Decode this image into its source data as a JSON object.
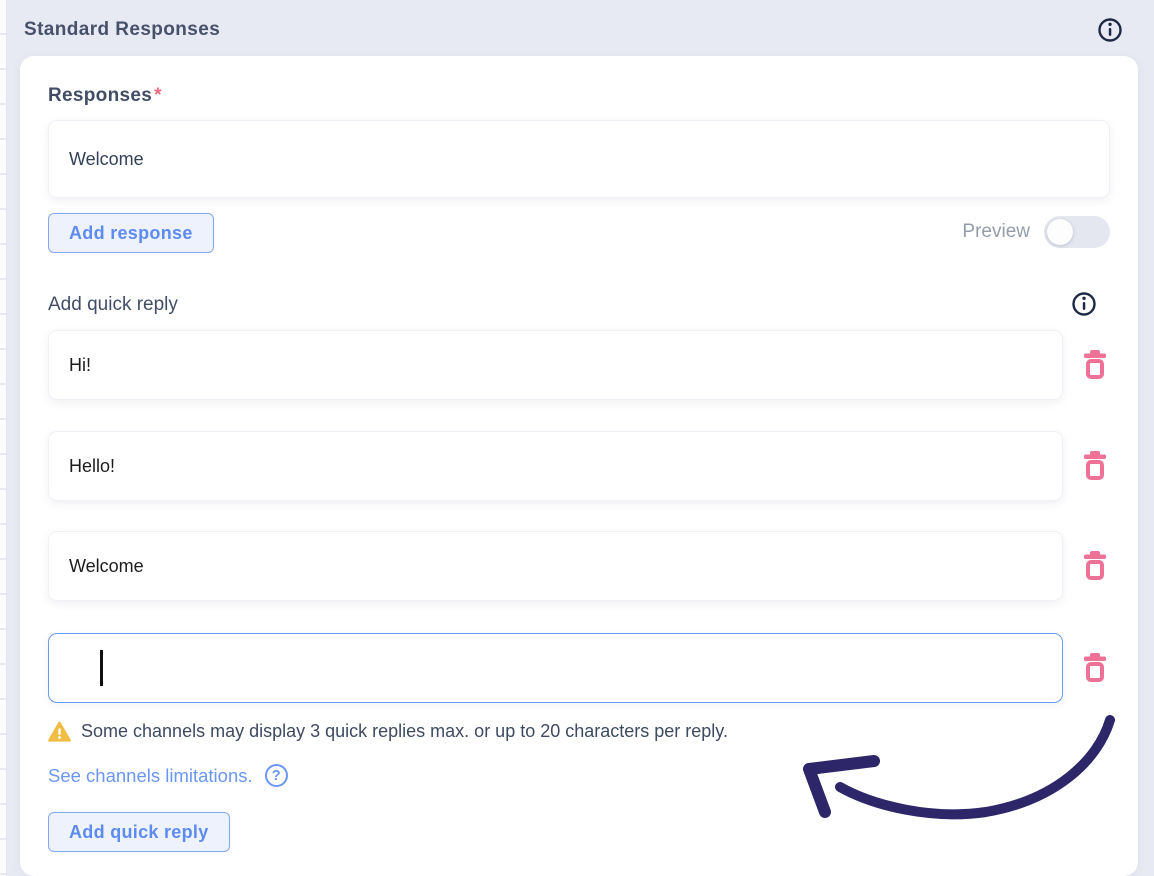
{
  "header": {
    "title": "Standard Responses",
    "info_icon": "info-icon"
  },
  "colors": {
    "background": "#e8eaf3",
    "card": "#ffffff",
    "accent_blue": "#5d8bf0",
    "button_bg": "#edf2fd",
    "button_border": "#84a6f1",
    "focused_border": "#699af6",
    "trash_pink": "#ee7295",
    "warning_amber": "#f0bd44",
    "required_red": "#f2697c",
    "arrow_indigo": "#2d2668",
    "dark_text": "#414d66",
    "muted_text": "#949cab"
  },
  "responses_section": {
    "label": "Responses",
    "required_marker": "*",
    "response_value": "Welcome",
    "add_button_label": "Add response",
    "preview_label": "Preview",
    "preview_state": "off"
  },
  "quick_reply_section": {
    "label": "Add quick reply",
    "info_icon": "info-icon",
    "replies": [
      "Hi!",
      "Hello!",
      "Welcome",
      ""
    ],
    "delete_icon": "trash-icon",
    "warning_icon": "warning-triangle-icon",
    "warning_text": "Some channels may display 3 quick replies max. or up to 20 characters per reply.",
    "link_label": "See channels limitations.",
    "help_icon": "question-circle-icon",
    "help_glyph": "?",
    "add_button_label": "Add quick reply"
  },
  "annotation": {
    "shape": "hand-drawn-arrow",
    "points_to": "empty-quick-reply-input"
  }
}
